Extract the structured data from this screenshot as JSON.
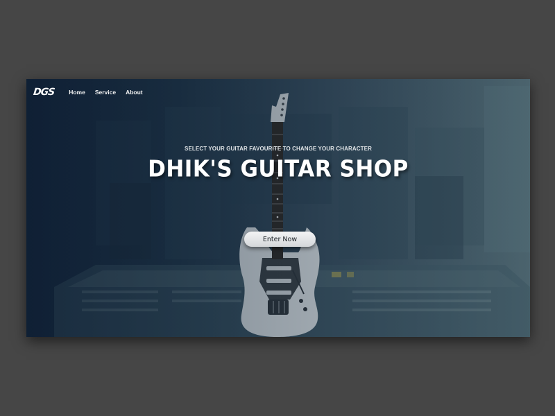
{
  "nav": {
    "logo": "DGS",
    "links": [
      "Home",
      "Service",
      "About"
    ]
  },
  "hero": {
    "tagline": "SELECT YOUR GUITAR FAVOURITE TO CHANGE YOUR CHARACTER",
    "title": "DHIK'S GUITAR SHOP",
    "cta_label": "Enter Now"
  },
  "colors": {
    "page_background": "#464646",
    "hero_gradient_start": "#13243a",
    "hero_gradient_end": "#4e6670",
    "text_primary": "#ffffff",
    "button_background": "#e6e8ea"
  },
  "icons": {
    "guitar": "electric-guitar-image"
  }
}
